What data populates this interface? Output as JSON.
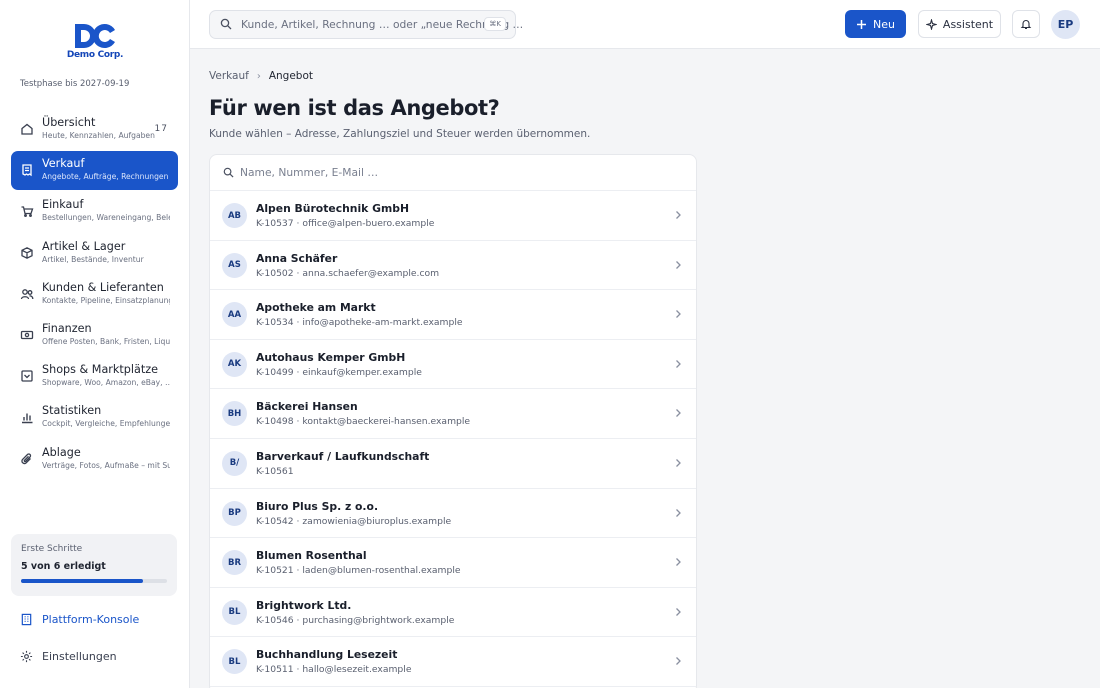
{
  "brand": {
    "logo_mark": "DC",
    "logo_text": "Demo Corp.",
    "accent": "#1a55c9"
  },
  "trial_text": "Testphase bis 2027-09-19",
  "sidebar": {
    "items": [
      {
        "label": "Übersicht",
        "sub": "Heute, Kennzahlen, Aufgaben",
        "icon": "home-icon",
        "count": "17",
        "active": false
      },
      {
        "label": "Verkauf",
        "sub": "Angebote, Aufträge, Rechnungen",
        "icon": "receipt-icon",
        "active": true
      },
      {
        "label": "Einkauf",
        "sub": "Bestellungen, Wareneingang, Belege",
        "icon": "cart-icon",
        "active": false
      },
      {
        "label": "Artikel & Lager",
        "sub": "Artikel, Bestände, Inventur",
        "icon": "box-icon",
        "active": false
      },
      {
        "label": "Kunden & Lieferanten",
        "sub": "Kontakte, Pipeline, Einsatzplanung",
        "icon": "users-icon",
        "active": false
      },
      {
        "label": "Finanzen",
        "sub": "Offene Posten, Bank, Fristen, Liquidität",
        "icon": "banknote-icon",
        "active": false
      },
      {
        "label": "Shops & Marktplätze",
        "sub": "Shopware, Woo, Amazon, eBay, …",
        "icon": "store-icon",
        "active": false
      },
      {
        "label": "Statistiken",
        "sub": "Cockpit, Vergleiche, Empfehlungen",
        "icon": "bar-chart-icon",
        "active": false
      },
      {
        "label": "Ablage",
        "sub": "Verträge, Fotos, Aufmaße – mit Suche",
        "icon": "paperclip-icon",
        "active": false
      }
    ],
    "progress": {
      "title": "Erste Schritte",
      "text": "5 von 6 erledigt",
      "fraction": 0.833
    },
    "console_label": "Plattform-Konsole",
    "settings_label": "Einstellungen"
  },
  "topbar": {
    "search_placeholder": "Kunde, Artikel, Rechnung … oder „neue Rechnung …",
    "search_shortcut": "⌘K",
    "new_label": "Neu",
    "assistant_label": "Assistent",
    "user_initials": "EP"
  },
  "main": {
    "breadcrumb": {
      "parent": "Verkauf",
      "current": "Angebot"
    },
    "title": "Für wen ist das Angebot?",
    "subtitle": "Kunde wählen – Adresse, Zahlungsziel und Steuer werden übernommen.",
    "search_placeholder": "Name, Nummer, E-Mail …",
    "customers": [
      {
        "initials": "AB",
        "name": "Alpen Bürotechnik GmbH",
        "meta": "K-10537 · office@alpen-buero.example"
      },
      {
        "initials": "AS",
        "name": "Anna Schäfer",
        "meta": "K-10502 · anna.schaefer@example.com"
      },
      {
        "initials": "AA",
        "name": "Apotheke am Markt",
        "meta": "K-10534 · info@apotheke-am-markt.example"
      },
      {
        "initials": "AK",
        "name": "Autohaus Kemper GmbH",
        "meta": "K-10499 · einkauf@kemper.example"
      },
      {
        "initials": "BH",
        "name": "Bäckerei Hansen",
        "meta": "K-10498 · kontakt@baeckerei-hansen.example"
      },
      {
        "initials": "B/",
        "name": "Barverkauf / Laufkundschaft",
        "meta": "K-10561"
      },
      {
        "initials": "BP",
        "name": "Biuro Plus Sp. z o.o.",
        "meta": "K-10542 · zamowienia@biuroplus.example"
      },
      {
        "initials": "BR",
        "name": "Blumen Rosenthal",
        "meta": "K-10521 · laden@blumen-rosenthal.example"
      },
      {
        "initials": "BL",
        "name": "Brightwork Ltd.",
        "meta": "K-10546 · purchasing@brightwork.example"
      },
      {
        "initials": "BL",
        "name": "Buchhandlung Lesezeit",
        "meta": "K-10511 · hallo@lesezeit.example"
      }
    ]
  }
}
